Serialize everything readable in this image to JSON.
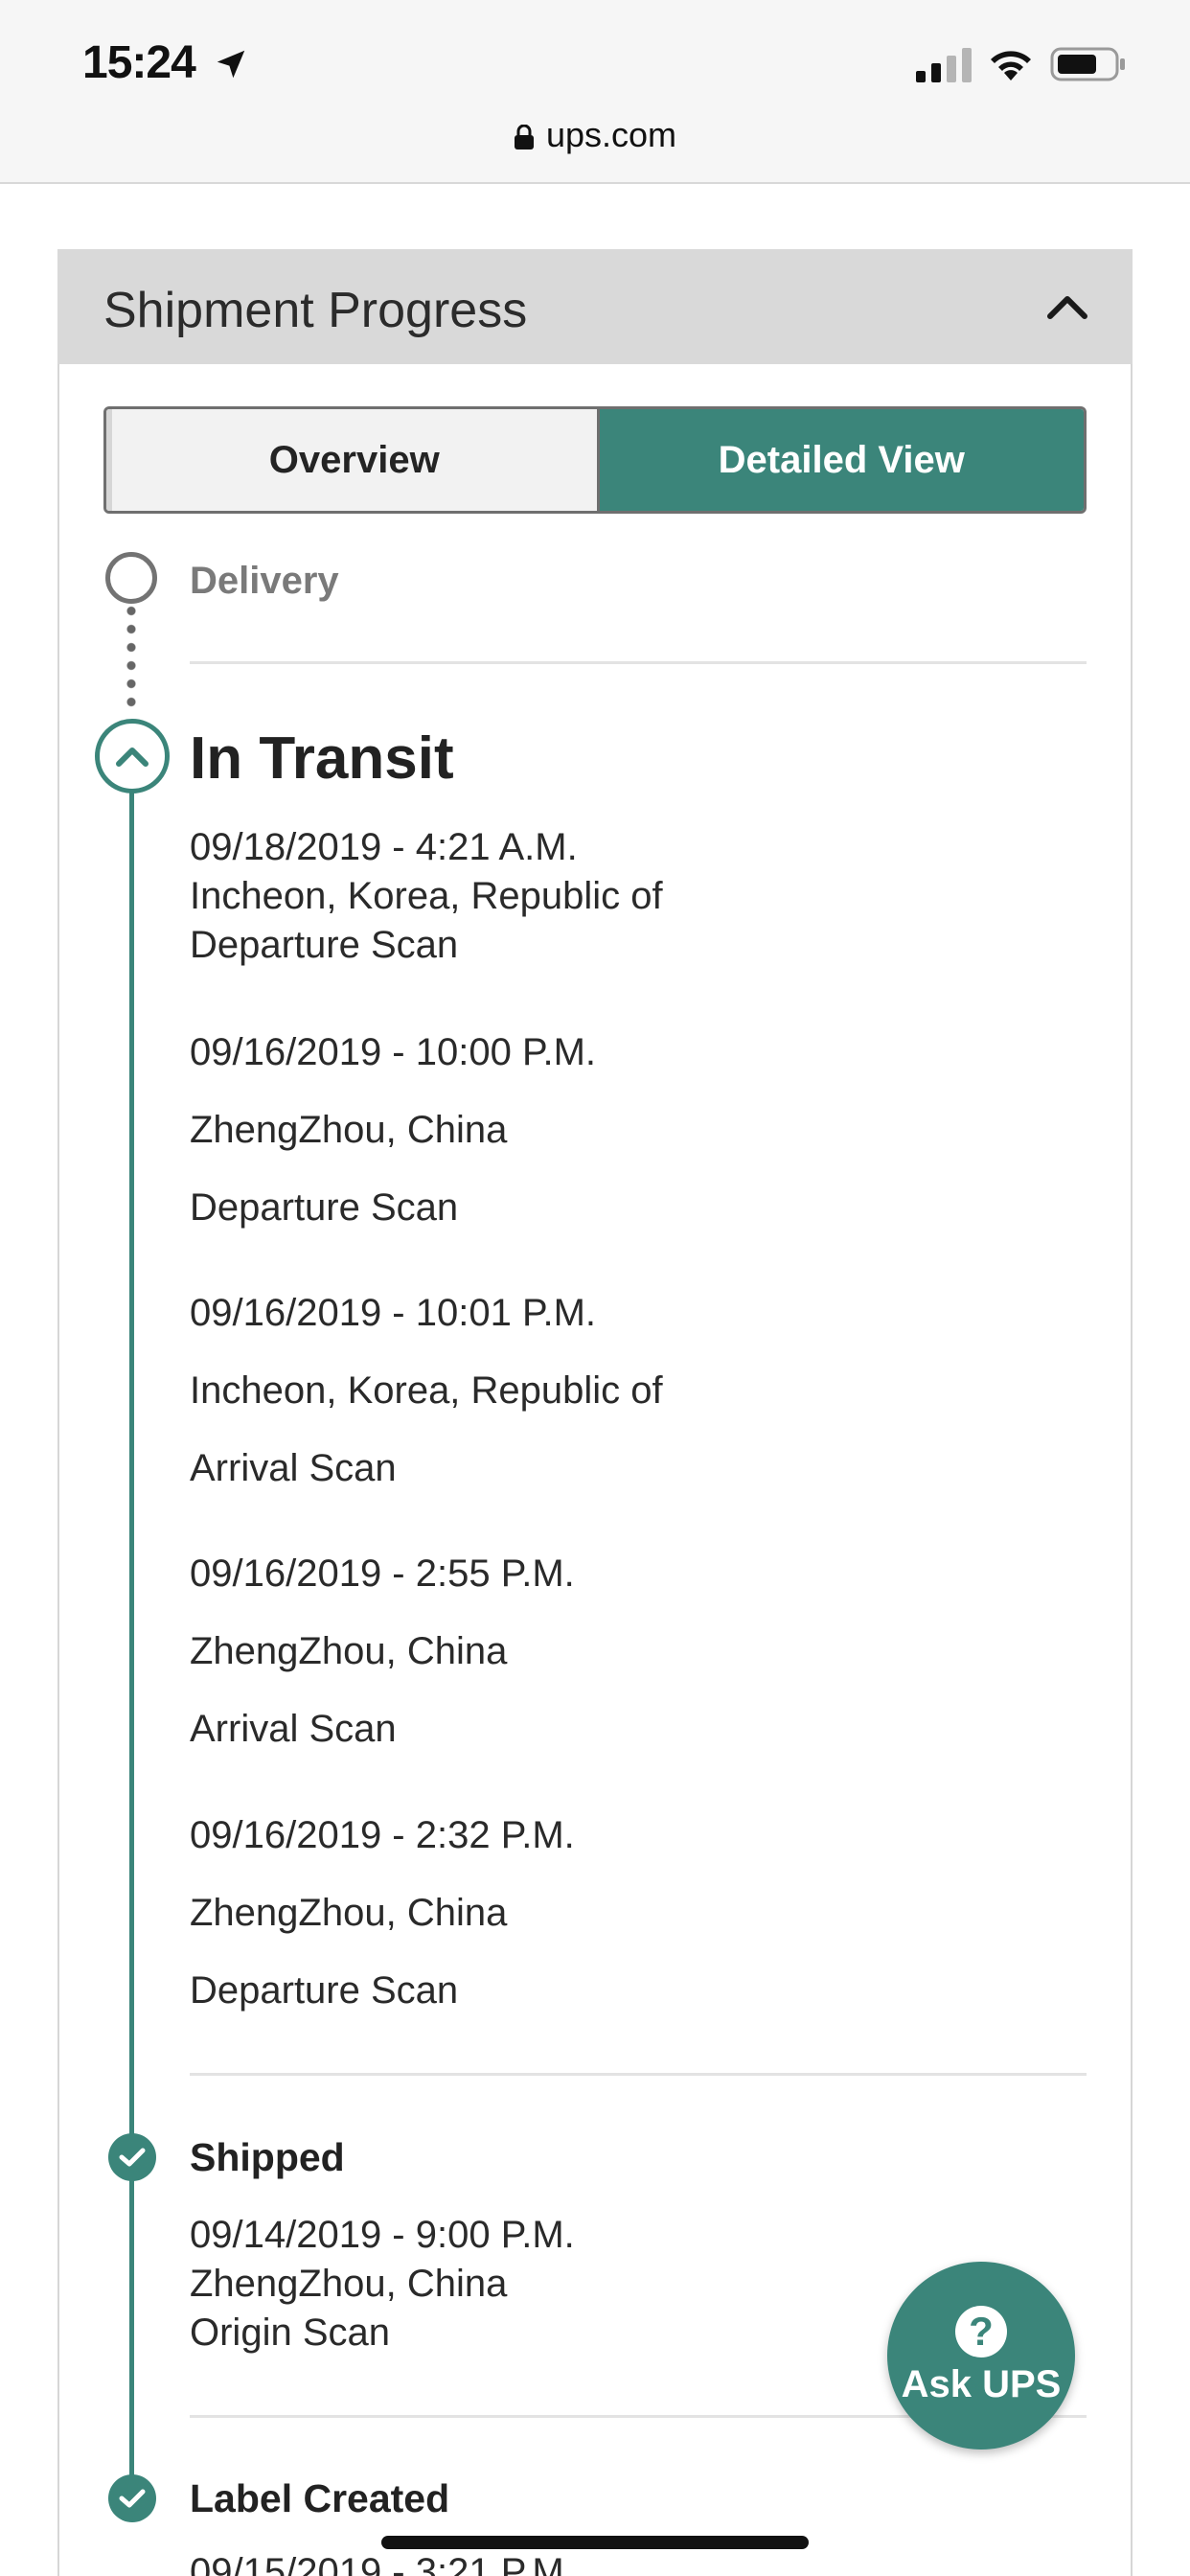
{
  "status_bar": {
    "time": "15:24",
    "url": "ups.com"
  },
  "card": {
    "title": "Shipment Progress"
  },
  "toggle": {
    "overview_label": "Overview",
    "detailed_label": "Detailed View",
    "selected": "Detailed View"
  },
  "timeline": {
    "delivery": {
      "label": "Delivery"
    },
    "in_transit": {
      "label": "In Transit",
      "events": [
        {
          "datetime": "09/18/2019 - 4:21 A.M.",
          "location": "Incheon, Korea, Republic of",
          "activity": "Departure Scan"
        },
        {
          "datetime": "09/16/2019 - 10:00 P.M.",
          "location": "ZhengZhou, China",
          "activity": "Departure Scan"
        },
        {
          "datetime": "09/16/2019 - 10:01 P.M.",
          "location": "Incheon, Korea, Republic of",
          "activity": "Arrival Scan"
        },
        {
          "datetime": "09/16/2019 - 2:55 P.M.",
          "location": "ZhengZhou, China",
          "activity": "Arrival Scan"
        },
        {
          "datetime": "09/16/2019 - 2:32 P.M.",
          "location": "ZhengZhou, China",
          "activity": "Departure Scan"
        }
      ]
    },
    "shipped": {
      "label": "Shipped",
      "datetime": "09/14/2019 - 9:00 P.M.",
      "location": "ZhengZhou, China",
      "activity": "Origin Scan"
    },
    "label_created": {
      "label": "Label Created",
      "datetime_partial": "09/15/2019 - 3:21 P.M."
    }
  },
  "ask_ups": {
    "label": "Ask UPS",
    "icon_glyph": "?"
  },
  "colors": {
    "accent": "#3b857a",
    "header_bg": "#d9d9d9",
    "status_bg": "#f6f6f6"
  }
}
